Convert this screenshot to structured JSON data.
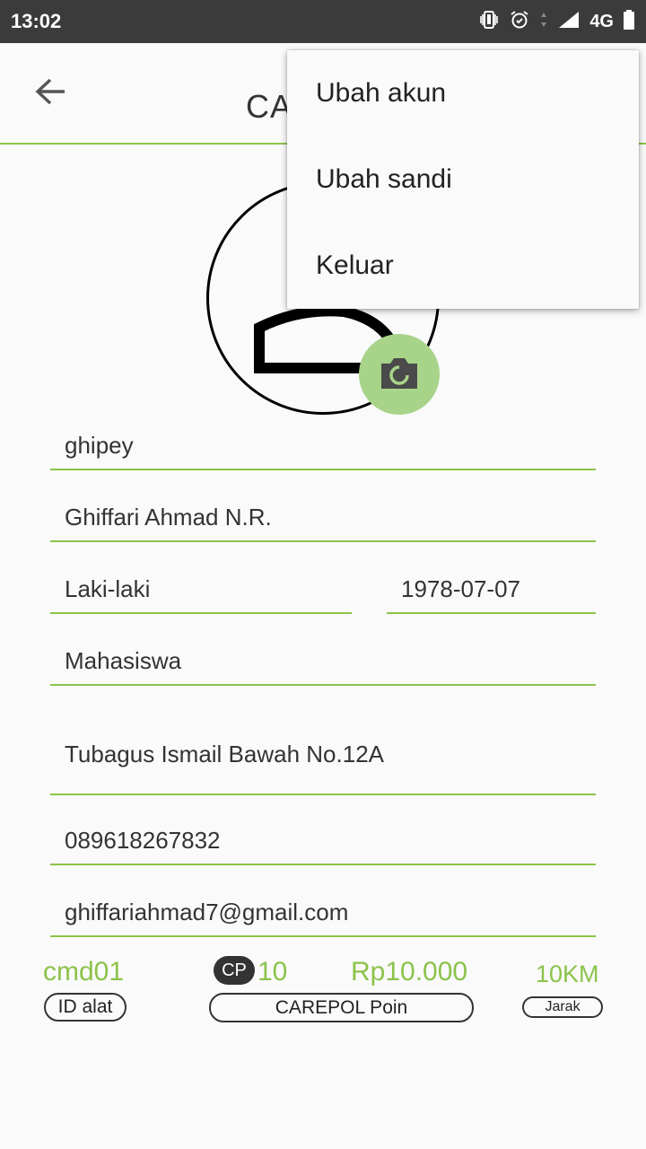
{
  "status_bar": {
    "time": "13:02",
    "network": "4G",
    "icons": [
      "vibrate-icon",
      "alarm-icon",
      "data-arrows-icon",
      "signal-icon",
      "battery-icon"
    ]
  },
  "header": {
    "title": "CA",
    "back_icon": "arrow-back-icon"
  },
  "profile": {
    "camera_icon": "camera-icon"
  },
  "form": {
    "username": "ghipey",
    "full_name": "Ghiffari Ahmad N.R.",
    "gender": "Laki-laki",
    "birth_date": "1978-07-07",
    "occupation": "Mahasiswa",
    "address": "Tubagus Ismail Bawah No.12A",
    "phone": "089618267832",
    "email": "ghiffariahmad7@gmail.com"
  },
  "stats": {
    "device_id": "cmd01",
    "device_id_label": "ID alat",
    "cp_badge": "CP",
    "points": "10",
    "points_value": "Rp10.000",
    "points_label": "CAREPOL Poin",
    "distance": "10KM",
    "distance_label": "Jarak"
  },
  "overflow_menu": {
    "items": [
      {
        "label": "Ubah akun"
      },
      {
        "label": "Ubah sandi"
      },
      {
        "label": "Keluar"
      }
    ]
  },
  "colors": {
    "accent": "#8bc34a",
    "status_bar": "#3b3b3b",
    "camera_button": "#a8d48a"
  }
}
